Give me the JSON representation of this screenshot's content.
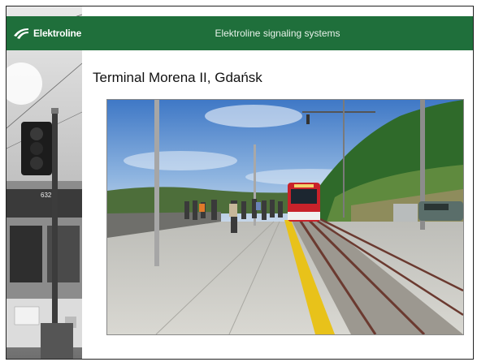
{
  "header": {
    "logo_text": "Elektroline",
    "title": "Elektroline signaling systems"
  },
  "slide": {
    "title": "Terminal Morena II, Gdańsk"
  },
  "side_photo": {
    "bus_number": "632"
  },
  "colors": {
    "header_green": "#1f6f3b",
    "tram_red": "#c8222a",
    "platform_yellow": "#e8c21a"
  },
  "icons": [
    "elektroline-logo-icon",
    "traffic-signal-icon"
  ]
}
